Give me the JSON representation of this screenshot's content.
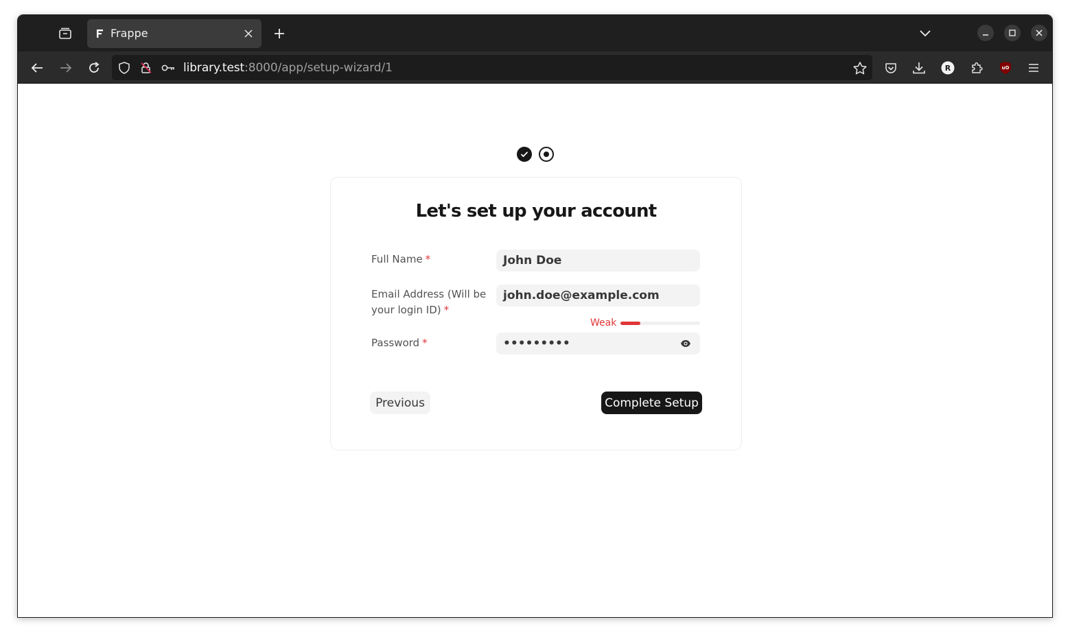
{
  "browser": {
    "tab_title": "Frappe",
    "url_host": "library.test",
    "url_rest": ":8000/app/setup-wizard/1",
    "profile_initial": "R",
    "extension_badge": "uO"
  },
  "wizard": {
    "steps": [
      {
        "state": "completed"
      },
      {
        "state": "current"
      }
    ],
    "title": "Let's set up your account",
    "fields": {
      "full_name": {
        "label": "Full Name",
        "required_mark": "*",
        "value": "John Doe"
      },
      "email": {
        "label_line1": "Email Address (Will be",
        "label_line2": "your login ID)",
        "required_mark": "*",
        "value": "john.doe@example.com"
      },
      "password": {
        "label": "Password",
        "required_mark": "*",
        "value": "•••••••••",
        "strength_label": "Weak",
        "strength_fraction": 0.25
      }
    },
    "buttons": {
      "previous": "Previous",
      "complete": "Complete Setup"
    }
  },
  "colors": {
    "accent": "#171717",
    "error": "#e03636",
    "input_bg": "#f3f3f3"
  }
}
